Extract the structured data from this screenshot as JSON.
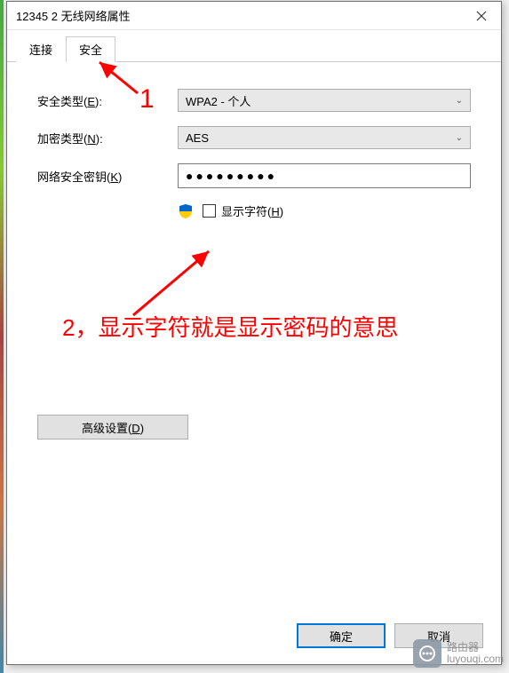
{
  "window": {
    "title": "12345 2 无线网络属性"
  },
  "tabs": {
    "connect": "连接",
    "security": "安全"
  },
  "form": {
    "security_type_label": "安全类型(E):",
    "security_type_accel": "E",
    "security_type_value": "WPA2 - 个人",
    "encryption_label": "加密类型(N):",
    "encryption_accel": "N",
    "encryption_value": "AES",
    "key_label": "网络安全密钥(K)",
    "key_accel": "K",
    "key_value": "●●●●●●●●●",
    "show_chars_label": "显示字符(H)",
    "show_chars_accel": "H",
    "advanced_label": "高级设置(D)",
    "advanced_accel": "D"
  },
  "buttons": {
    "ok": "确定",
    "cancel": "取消"
  },
  "annotations": {
    "one": "1",
    "two": "2，显示字符就是显示密码的意思"
  },
  "watermark": {
    "line1": "路由器",
    "line2": "luyouqi.com"
  }
}
